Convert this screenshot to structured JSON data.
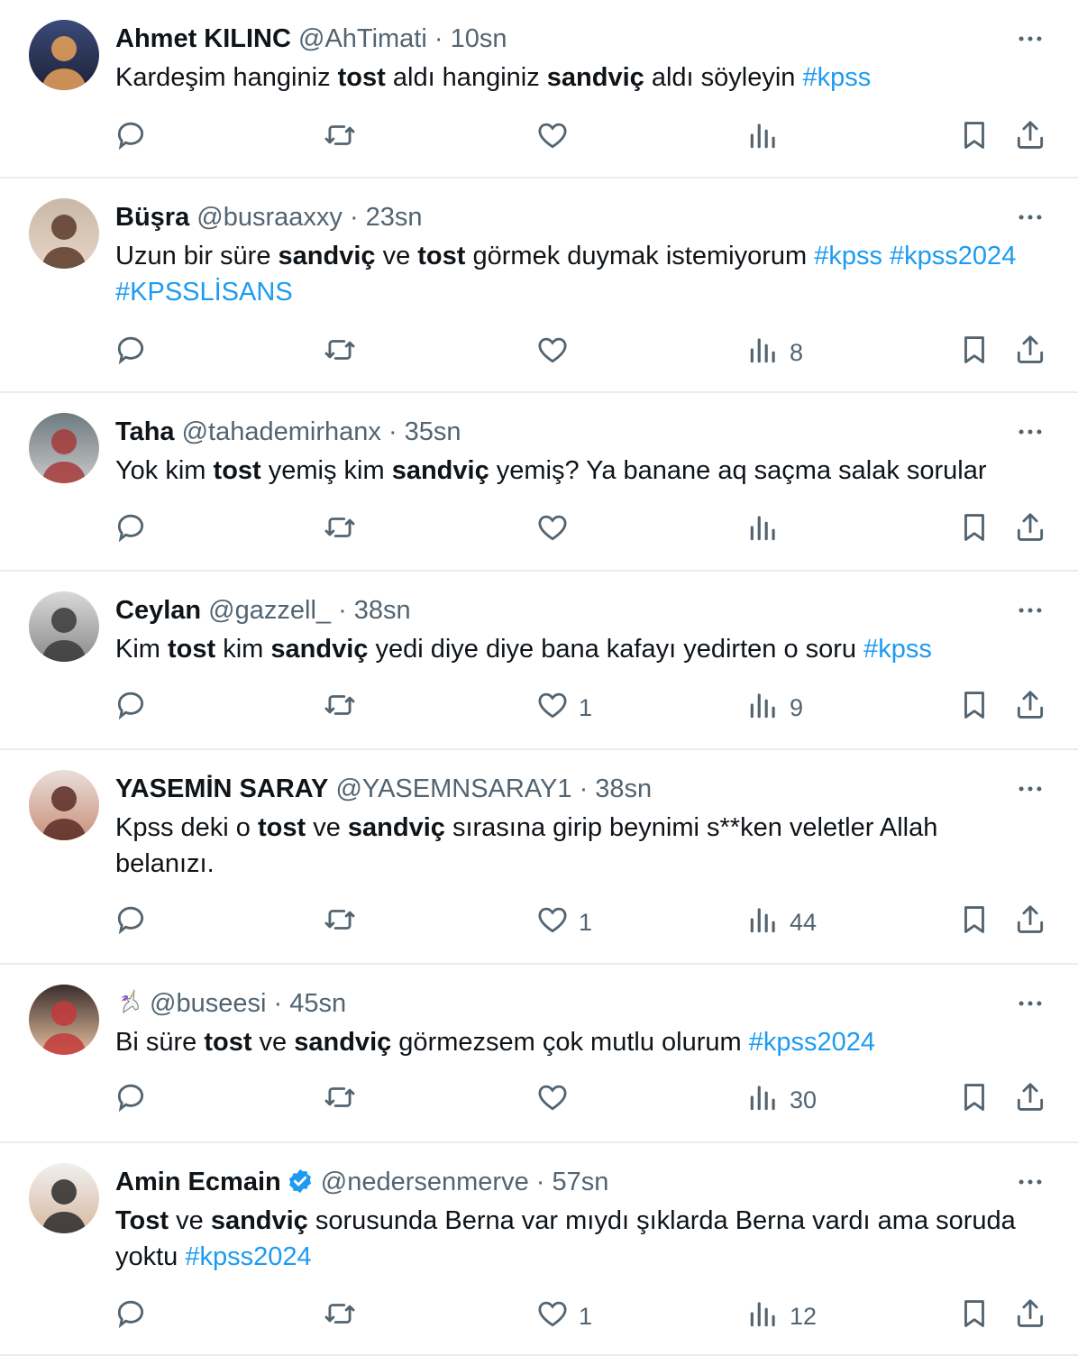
{
  "tweets": [
    {
      "name": "Ahmet KILINC",
      "handle": "@AhTimati",
      "time": "10sn",
      "text": [
        {
          "t": "Kardeşim hanginiz "
        },
        {
          "t": "tost",
          "b": true
        },
        {
          "t": " aldı hanginiz "
        },
        {
          "t": "sandviç",
          "b": true
        },
        {
          "t": " aldı söyleyin  "
        },
        {
          "t": "#kpss",
          "tag": true
        }
      ],
      "likes": "",
      "views": "",
      "avatar_colors": [
        "#3b4a7a",
        "#e9a25b",
        "#1c2236"
      ]
    },
    {
      "name": "Büşra",
      "handle": "@busraaxxy",
      "time": "23sn",
      "text": [
        {
          "t": "Uzun bir süre "
        },
        {
          "t": "sandviç",
          "b": true
        },
        {
          "t": " ve "
        },
        {
          "t": "tost",
          "b": true
        },
        {
          "t": " görmek duymak istemiyorum "
        },
        {
          "t": "#kpss",
          "tag": true
        },
        {
          "t": " "
        },
        {
          "t": "#kpss2024",
          "tag": true
        },
        {
          "t": " "
        },
        {
          "t": "#KPSSLİSANS",
          "tag": true
        }
      ],
      "likes": "",
      "views": "8",
      "avatar_colors": [
        "#c9b8a8",
        "#5a3a2a",
        "#e8d4c4"
      ]
    },
    {
      "name": "Taha",
      "handle": "@tahademirhanx",
      "time": "35sn",
      "text": [
        {
          "t": "Yok kim "
        },
        {
          "t": "tost",
          "b": true
        },
        {
          "t": " yemiş kim "
        },
        {
          "t": "sandviç",
          "b": true
        },
        {
          "t": " yemiş?  Ya banane aq saçma salak sorular"
        }
      ],
      "likes": "",
      "views": "",
      "avatar_colors": [
        "#6e7a80",
        "#a63a3a",
        "#c9c9c9"
      ]
    },
    {
      "name": "Ceylan",
      "handle": "@gazzell_",
      "time": "38sn",
      "text": [
        {
          "t": "Kim "
        },
        {
          "t": "tost",
          "b": true
        },
        {
          "t": " kim "
        },
        {
          "t": "sandviç",
          "b": true
        },
        {
          "t": " yedi diye diye bana kafayı yedirten o soru "
        },
        {
          "t": "#kpss",
          "tag": true
        }
      ],
      "likes": "1",
      "views": "9",
      "avatar_colors": [
        "#d9d9d9",
        "#3a3a3a",
        "#8a8a8a"
      ]
    },
    {
      "name": "YASEMİN SARAY",
      "handle": "@YASEMNSARAY1",
      "time": "38sn",
      "text": [
        {
          "t": "Kpss deki o "
        },
        {
          "t": "tost",
          "b": true
        },
        {
          "t": " ve "
        },
        {
          "t": "sandviç",
          "b": true
        },
        {
          "t": " sırasına girip beynimi s**ken veletler Allah belanızı."
        }
      ],
      "likes": "1",
      "views": "44",
      "avatar_colors": [
        "#e9ded8",
        "#5b2d24",
        "#c98f7a"
      ]
    },
    {
      "name": "",
      "handle": "@buseesi",
      "time": "45sn",
      "emoji_name": "unicorn-emoji",
      "text": [
        {
          "t": "Bi süre "
        },
        {
          "t": "tost",
          "b": true
        },
        {
          "t": " ve "
        },
        {
          "t": "sandviç",
          "b": true
        },
        {
          "t": " görmezsem çok mutlu olurum "
        },
        {
          "t": "#kpss2024",
          "tag": true
        }
      ],
      "likes": "",
      "views": "30",
      "avatar_colors": [
        "#3a2c2c",
        "#c23a3a",
        "#e6c2a0"
      ]
    },
    {
      "name": "Amin Ecmain",
      "handle": "@nedersenmerve",
      "time": "57sn",
      "verified": true,
      "text": [
        {
          "t": "Tost",
          "b": true
        },
        {
          "t": " ve "
        },
        {
          "t": "sandviç",
          "b": true
        },
        {
          "t": " sorusunda Berna var mıydı şıklarda Berna vardı ama soruda yoktu "
        },
        {
          "t": "#kpss2024",
          "tag": true
        }
      ],
      "likes": "1",
      "views": "12",
      "avatar_colors": [
        "#f0f0f0",
        "#2a2a2a",
        "#d8b8a0"
      ]
    }
  ],
  "colors": {
    "text": "#0f1419",
    "secondary": "#536471",
    "link": "#1d9bf0",
    "verified": "#1d9bf0",
    "divider": "#e9ecee"
  },
  "icons": [
    "reply-icon",
    "retweet-icon",
    "like-icon",
    "views-icon",
    "bookmark-icon",
    "share-icon",
    "more-icon",
    "verified-icon"
  ]
}
